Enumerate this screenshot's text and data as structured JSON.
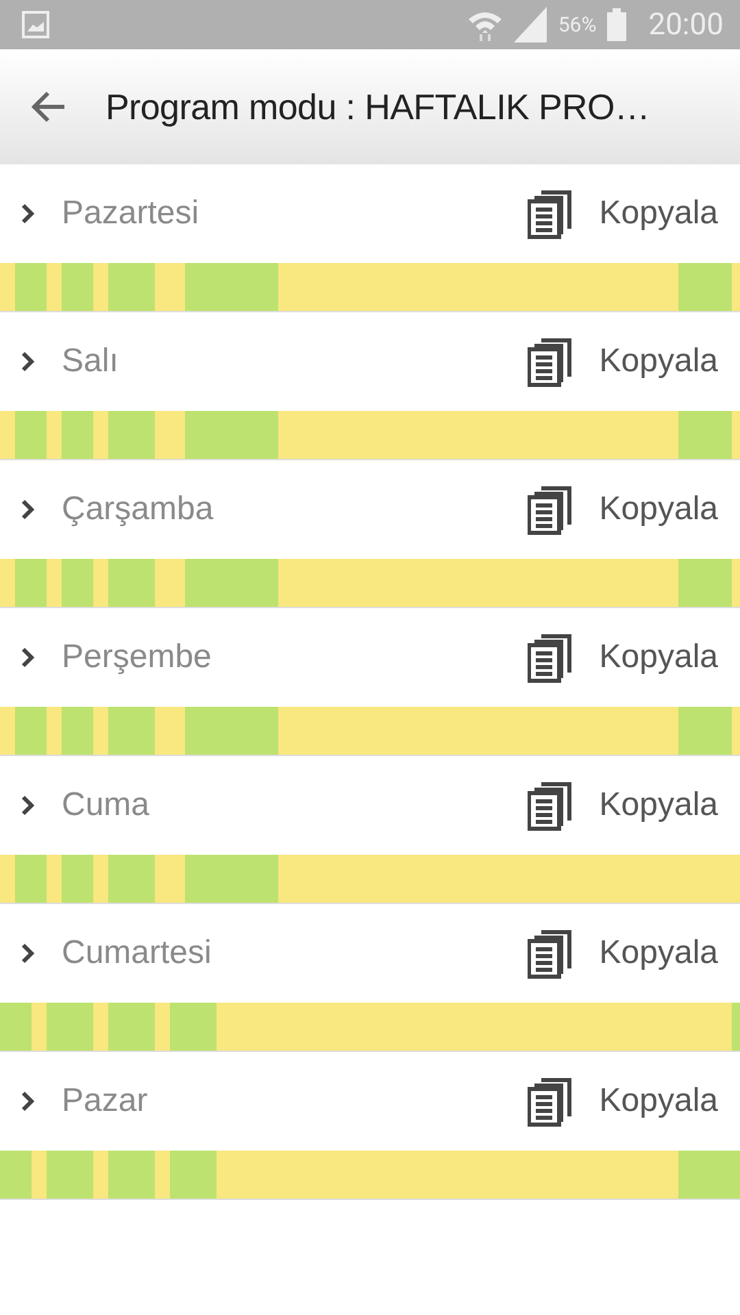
{
  "status_bar": {
    "battery_text": "56%",
    "time": "20:00"
  },
  "app_bar": {
    "title": "Program modu : HAFTALIK PRO…"
  },
  "days": [
    {
      "name": "Pazartesi",
      "action": "Kopyala",
      "expanded": false,
      "slots": [
        false,
        false,
        true,
        true,
        true,
        true,
        false,
        false,
        true,
        true,
        true,
        true,
        false,
        false,
        true,
        true,
        true,
        true,
        true,
        true,
        false,
        false,
        false,
        false,
        true,
        true,
        true,
        true,
        true,
        true,
        true,
        true,
        true,
        true,
        true,
        true,
        false,
        false,
        false,
        false,
        false,
        false,
        false,
        false,
        false,
        false,
        false,
        false,
        false,
        false,
        false,
        false,
        false,
        false,
        false,
        false,
        false,
        false,
        false,
        false,
        false,
        false,
        false,
        false,
        false,
        false,
        false,
        false,
        false,
        false,
        false,
        false,
        false,
        false,
        false,
        false,
        false,
        false,
        false,
        false,
        false,
        false,
        false,
        false,
        false,
        false,
        false,
        false,
        true,
        true,
        true,
        true,
        true,
        true,
        true,
        false
      ]
    },
    {
      "name": "Salı",
      "action": "Kopyala",
      "expanded": false,
      "slots": [
        false,
        false,
        true,
        true,
        true,
        true,
        false,
        false,
        true,
        true,
        true,
        true,
        false,
        false,
        true,
        true,
        true,
        true,
        true,
        true,
        false,
        false,
        false,
        false,
        true,
        true,
        true,
        true,
        true,
        true,
        true,
        true,
        true,
        true,
        true,
        true,
        false,
        false,
        false,
        false,
        false,
        false,
        false,
        false,
        false,
        false,
        false,
        false,
        false,
        false,
        false,
        false,
        false,
        false,
        false,
        false,
        false,
        false,
        false,
        false,
        false,
        false,
        false,
        false,
        false,
        false,
        false,
        false,
        false,
        false,
        false,
        false,
        false,
        false,
        false,
        false,
        false,
        false,
        false,
        false,
        false,
        false,
        false,
        false,
        false,
        false,
        false,
        false,
        true,
        true,
        true,
        true,
        true,
        true,
        true,
        false
      ]
    },
    {
      "name": "Çarşamba",
      "action": "Kopyala",
      "expanded": false,
      "slots": [
        false,
        false,
        true,
        true,
        true,
        true,
        false,
        false,
        true,
        true,
        true,
        true,
        false,
        false,
        true,
        true,
        true,
        true,
        true,
        true,
        false,
        false,
        false,
        false,
        true,
        true,
        true,
        true,
        true,
        true,
        true,
        true,
        true,
        true,
        true,
        true,
        false,
        false,
        false,
        false,
        false,
        false,
        false,
        false,
        false,
        false,
        false,
        false,
        false,
        false,
        false,
        false,
        false,
        false,
        false,
        false,
        false,
        false,
        false,
        false,
        false,
        false,
        false,
        false,
        false,
        false,
        false,
        false,
        false,
        false,
        false,
        false,
        false,
        false,
        false,
        false,
        false,
        false,
        false,
        false,
        false,
        false,
        false,
        false,
        false,
        false,
        false,
        false,
        true,
        true,
        true,
        true,
        true,
        true,
        true,
        false
      ]
    },
    {
      "name": "Perşembe",
      "action": "Kopyala",
      "expanded": false,
      "slots": [
        false,
        false,
        true,
        true,
        true,
        true,
        false,
        false,
        true,
        true,
        true,
        true,
        false,
        false,
        true,
        true,
        true,
        true,
        true,
        true,
        false,
        false,
        false,
        false,
        true,
        true,
        true,
        true,
        true,
        true,
        true,
        true,
        true,
        true,
        true,
        true,
        false,
        false,
        false,
        false,
        false,
        false,
        false,
        false,
        false,
        false,
        false,
        false,
        false,
        false,
        false,
        false,
        false,
        false,
        false,
        false,
        false,
        false,
        false,
        false,
        false,
        false,
        false,
        false,
        false,
        false,
        false,
        false,
        false,
        false,
        false,
        false,
        false,
        false,
        false,
        false,
        false,
        false,
        false,
        false,
        false,
        false,
        false,
        false,
        false,
        false,
        false,
        false,
        true,
        true,
        true,
        true,
        true,
        true,
        true,
        false
      ]
    },
    {
      "name": "Cuma",
      "action": "Kopyala",
      "expanded": false,
      "slots": [
        false,
        false,
        true,
        true,
        true,
        true,
        false,
        false,
        true,
        true,
        true,
        true,
        false,
        false,
        true,
        true,
        true,
        true,
        true,
        true,
        false,
        false,
        false,
        false,
        true,
        true,
        true,
        true,
        true,
        true,
        true,
        true,
        true,
        true,
        true,
        true,
        false,
        false,
        false,
        false,
        false,
        false,
        false,
        false,
        false,
        false,
        false,
        false,
        false,
        false,
        false,
        false,
        false,
        false,
        false,
        false,
        false,
        false,
        false,
        false,
        false,
        false,
        false,
        false,
        false,
        false,
        false,
        false,
        false,
        false,
        false,
        false,
        false,
        false,
        false,
        false,
        false,
        false,
        false,
        false,
        false,
        false,
        false,
        false,
        false,
        false,
        false,
        false,
        false,
        false,
        false,
        false,
        false,
        false,
        false,
        false
      ]
    },
    {
      "name": "Cumartesi",
      "action": "Kopyala",
      "expanded": false,
      "slots": [
        true,
        true,
        true,
        true,
        false,
        false,
        true,
        true,
        true,
        true,
        true,
        true,
        false,
        false,
        true,
        true,
        true,
        true,
        true,
        true,
        false,
        false,
        true,
        true,
        true,
        true,
        true,
        true,
        false,
        false,
        false,
        false,
        false,
        false,
        false,
        false,
        false,
        false,
        false,
        false,
        false,
        false,
        false,
        false,
        false,
        false,
        false,
        false,
        false,
        false,
        false,
        false,
        false,
        false,
        false,
        false,
        false,
        false,
        false,
        false,
        false,
        false,
        false,
        false,
        false,
        false,
        false,
        false,
        false,
        false,
        false,
        false,
        false,
        false,
        false,
        false,
        false,
        false,
        false,
        false,
        false,
        false,
        false,
        false,
        false,
        false,
        false,
        false,
        false,
        false,
        false,
        false,
        false,
        false,
        false,
        true
      ]
    },
    {
      "name": "Pazar",
      "action": "Kopyala",
      "expanded": false,
      "slots": [
        true,
        true,
        true,
        true,
        false,
        false,
        true,
        true,
        true,
        true,
        true,
        true,
        false,
        false,
        true,
        true,
        true,
        true,
        true,
        true,
        false,
        false,
        true,
        true,
        true,
        true,
        true,
        true,
        false,
        false,
        false,
        false,
        false,
        false,
        false,
        false,
        false,
        false,
        false,
        false,
        false,
        false,
        false,
        false,
        false,
        false,
        false,
        false,
        false,
        false,
        false,
        false,
        false,
        false,
        false,
        false,
        false,
        false,
        false,
        false,
        false,
        false,
        false,
        false,
        false,
        false,
        false,
        false,
        false,
        false,
        false,
        false,
        false,
        false,
        false,
        false,
        false,
        false,
        false,
        false,
        false,
        false,
        false,
        false,
        false,
        false,
        false,
        false,
        true,
        true,
        true,
        true,
        true,
        true,
        true,
        true
      ]
    }
  ]
}
